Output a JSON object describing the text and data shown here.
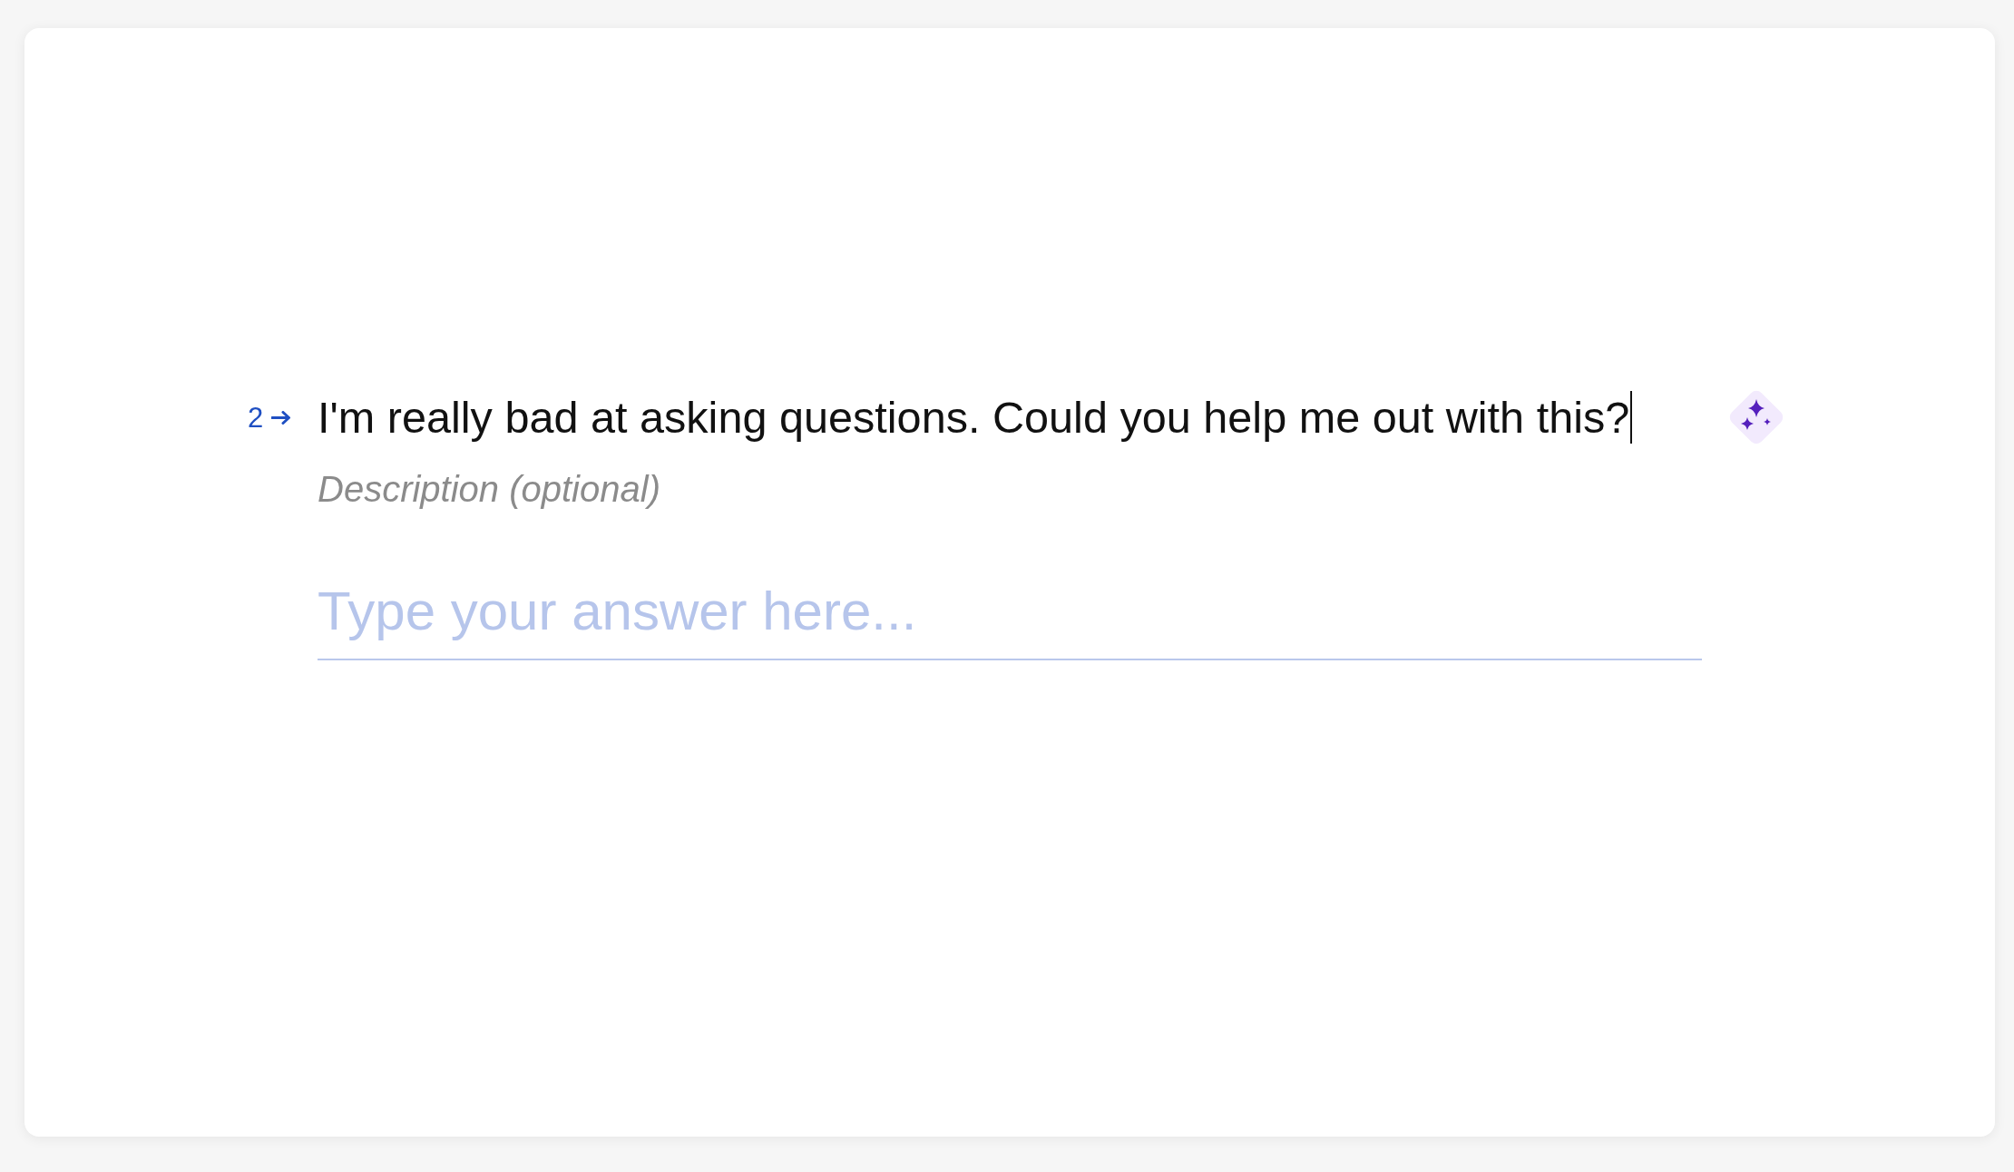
{
  "question": {
    "number": "2",
    "title": "I'm really bad at asking questions. Could you help me out with this?",
    "title_focused": true,
    "description_placeholder": "Description (optional)"
  },
  "answer": {
    "placeholder": "Type your answer here..."
  }
}
